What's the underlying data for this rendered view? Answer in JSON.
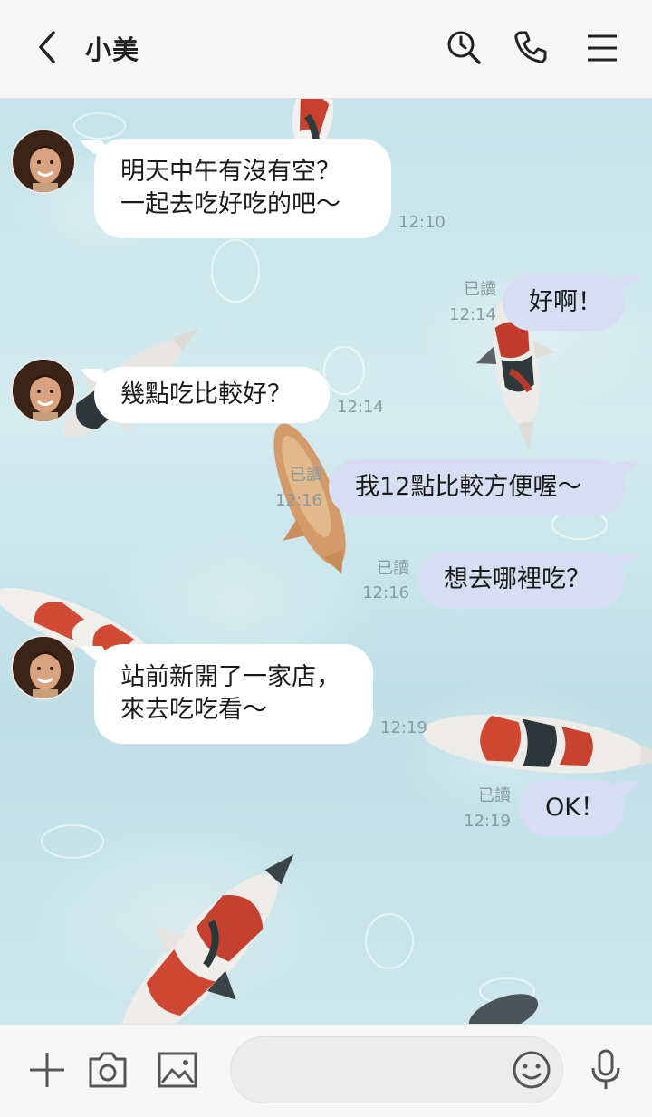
{
  "header": {
    "title": "小美",
    "icons": [
      "back-arrow-icon",
      "search-icon",
      "phone-icon",
      "menu-icon"
    ]
  },
  "messages": [
    {
      "side": "in",
      "lines": [
        "明天中午有沒有空？",
        "一起去吃好吃的吧～"
      ],
      "time": "12:10"
    },
    {
      "side": "out",
      "lines": [
        "好啊！"
      ],
      "read": "已讀",
      "time": "12:14"
    },
    {
      "side": "in",
      "lines": [
        "幾點吃比較好？"
      ],
      "time": "12:14"
    },
    {
      "side": "out",
      "lines": [
        "我12點比較方便喔～"
      ],
      "read": "已讀",
      "time": "12:16"
    },
    {
      "side": "out",
      "lines": [
        "想去哪裡吃？"
      ],
      "read": "已讀",
      "time": "12:16"
    },
    {
      "side": "in",
      "lines": [
        "站前新開了一家店，",
        "來去吃吃看～"
      ],
      "time": "12:19"
    },
    {
      "side": "out",
      "lines": [
        "OK！"
      ],
      "read": "已讀",
      "time": "12:19"
    }
  ],
  "footer": {
    "input_placeholder": "",
    "icons": [
      "plus-icon",
      "camera-icon",
      "image-icon",
      "emoji-icon",
      "microphone-icon"
    ]
  },
  "colors": {
    "outgoing_bubble": "#d7def4",
    "incoming_bubble": "#ffffff",
    "water": "#c4e3ea"
  }
}
